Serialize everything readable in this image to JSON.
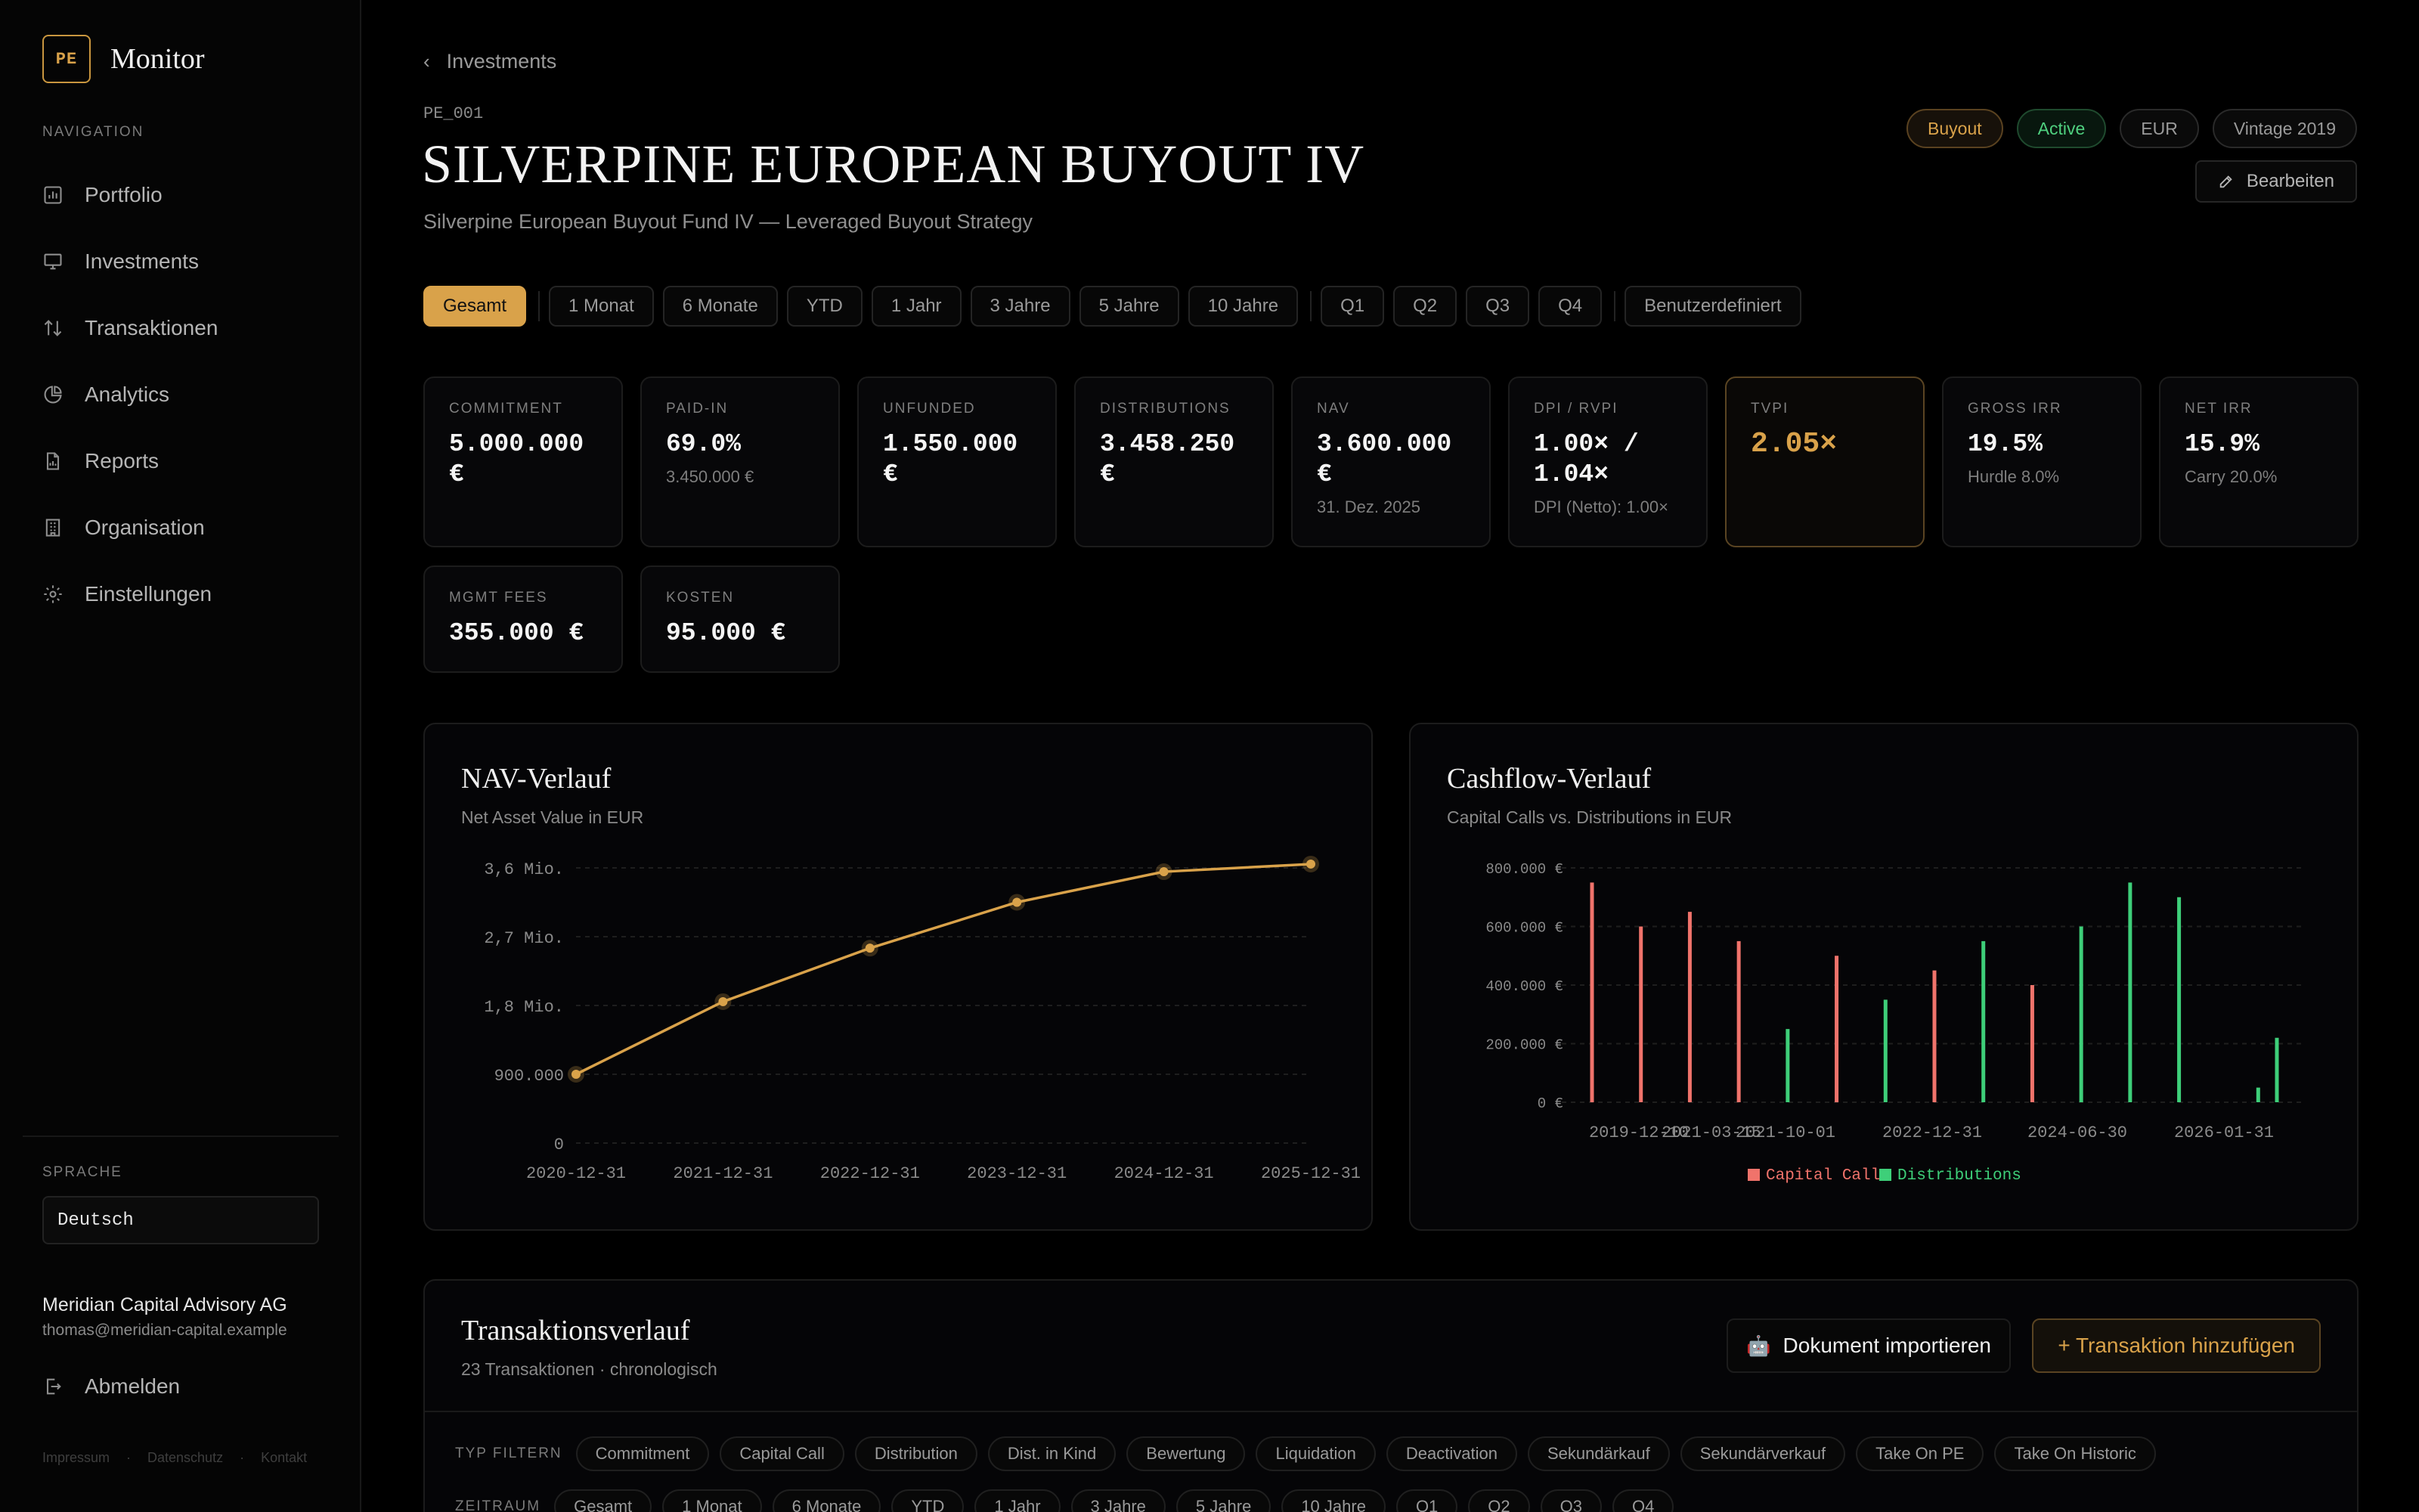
{
  "brand": {
    "badge": "PE",
    "name": "Monitor"
  },
  "sidebar": {
    "heading": "NAVIGATION",
    "items": [
      {
        "label": "Portfolio",
        "icon": "bar-chart-icon"
      },
      {
        "label": "Investments",
        "icon": "monitor-icon"
      },
      {
        "label": "Transaktionen",
        "icon": "arrows-updown-icon"
      },
      {
        "label": "Analytics",
        "icon": "pie-chart-icon"
      },
      {
        "label": "Reports",
        "icon": "file-chart-icon"
      },
      {
        "label": "Organisation",
        "icon": "building-icon"
      },
      {
        "label": "Einstellungen",
        "icon": "gear-icon"
      }
    ],
    "language_heading": "SPRACHE",
    "language_value": "Deutsch",
    "org_name": "Meridian Capital Advisory AG",
    "org_email": "thomas@meridian-capital.example",
    "logout_label": "Abmelden",
    "footer": [
      "Impressum",
      "·",
      "Datenschutz",
      "·",
      "Kontakt"
    ]
  },
  "header": {
    "back_label": "Investments",
    "code": "PE_001",
    "title": "SILVERPINE EUROPEAN BUYOUT IV",
    "subtitle": "Silverpine European Buyout Fund IV — Leveraged Buyout Strategy",
    "tags": [
      "Buyout",
      "Active",
      "EUR",
      "Vintage 2019"
    ],
    "edit_label": "Bearbeiten"
  },
  "periods": {
    "group1": [
      "Gesamt"
    ],
    "group2": [
      "1 Monat",
      "6 Monate",
      "YTD",
      "1 Jahr",
      "3 Jahre",
      "5 Jahre",
      "10 Jahre"
    ],
    "group3": [
      "Q1",
      "Q2",
      "Q3",
      "Q4"
    ],
    "group4": [
      "Benutzerdefiniert"
    ],
    "selected": "Gesamt"
  },
  "kpis": [
    {
      "label": "COMMITMENT",
      "value": "5.000.000 €",
      "sub": ""
    },
    {
      "label": "PAID-IN",
      "value": "69.0%",
      "sub": "3.450.000 €"
    },
    {
      "label": "UNFUNDED",
      "value": "1.550.000 €",
      "sub": ""
    },
    {
      "label": "DISTRIBUTIONS",
      "value": "3.458.250 €",
      "sub": ""
    },
    {
      "label": "NAV",
      "value": "3.600.000 €",
      "sub": "31. Dez. 2025"
    },
    {
      "label": "DPI / RVPI",
      "value": "1.00× / 1.04×",
      "sub": "DPI (Netto): 1.00×"
    },
    {
      "label": "TVPI",
      "value": "2.05×",
      "sub": ""
    },
    {
      "label": "GROSS IRR",
      "value": "19.5%",
      "sub": "Hurdle 8.0%"
    },
    {
      "label": "NET IRR",
      "value": "15.9%",
      "sub": "Carry 20.0%"
    },
    {
      "label": "MGMT FEES",
      "value": "355.000 €",
      "sub": ""
    },
    {
      "label": "KOSTEN",
      "value": "95.000 €",
      "sub": ""
    }
  ],
  "nav_chart": {
    "title": "NAV-Verlauf",
    "subtitle": "Net Asset Value in EUR"
  },
  "cf_chart": {
    "title": "Cashflow-Verlauf",
    "subtitle": "Capital Calls vs. Distributions in EUR"
  },
  "chart_data": [
    {
      "type": "line",
      "x": [
        "2020-12-31",
        "2021-12-31",
        "2022-12-31",
        "2023-12-31",
        "2024-12-31",
        "2025-12-31"
      ],
      "series": [
        {
          "values": [
            900000,
            1850000,
            2550000,
            3150000,
            3550000,
            3650000
          ]
        }
      ],
      "yticks": [
        "0",
        "900.000",
        "1,8 Mio.",
        "2,7 Mio.",
        "3,6 Mio."
      ],
      "ylim": [
        0,
        3600000
      ],
      "grid": true,
      "color": "#d9a24a"
    },
    {
      "type": "bar",
      "xticks": [
        "2019-12-10",
        "2021-03-15",
        "2021-10-01",
        "2022-12-31",
        "2024-06-30",
        "2026-01-31"
      ],
      "yticks": [
        "0 €",
        "200.000 €",
        "400.000 €",
        "600.000 €",
        "800.000 €"
      ],
      "ylim": [
        0,
        800000
      ],
      "grid": true,
      "legend_position": "bottom",
      "series": [
        {
          "name": "Capital Calls",
          "color": "#f0736b",
          "values": [
            750000,
            600000,
            650000,
            550000,
            500000,
            450000,
            400000
          ]
        },
        {
          "name": "Distributions",
          "color": "#3ecf79",
          "values": [
            250000,
            350000,
            550000,
            600000,
            750000,
            700000,
            50000,
            220000
          ]
        }
      ]
    }
  ],
  "transactions": {
    "title": "Transaktionsverlauf",
    "subtitle": "23 Transaktionen · chronologisch",
    "import_label": "Dokument importieren",
    "add_label": "+ Transaktion hinzufügen",
    "type_filter_label": "TYP FILTERN",
    "type_filters": [
      "Commitment",
      "Capital Call",
      "Distribution",
      "Dist. in Kind",
      "Bewertung",
      "Liquidation",
      "Deactivation",
      "Sekundärkauf",
      "Sekundärverkauf",
      "Take On PE",
      "Take On Historic"
    ],
    "period_filter_label": "ZEITRAUM",
    "period_filters": [
      "Gesamt",
      "1 Monat",
      "6 Monate",
      "YTD",
      "1 Jahr",
      "3 Jahre",
      "5 Jahre",
      "10 Jahre",
      "Q1",
      "Q2",
      "Q3",
      "Q4"
    ]
  },
  "colors": {
    "accent": "#d9a24a",
    "active": "#4fd07f",
    "capital_calls": "#f0736b",
    "distributions": "#3ecf79"
  }
}
